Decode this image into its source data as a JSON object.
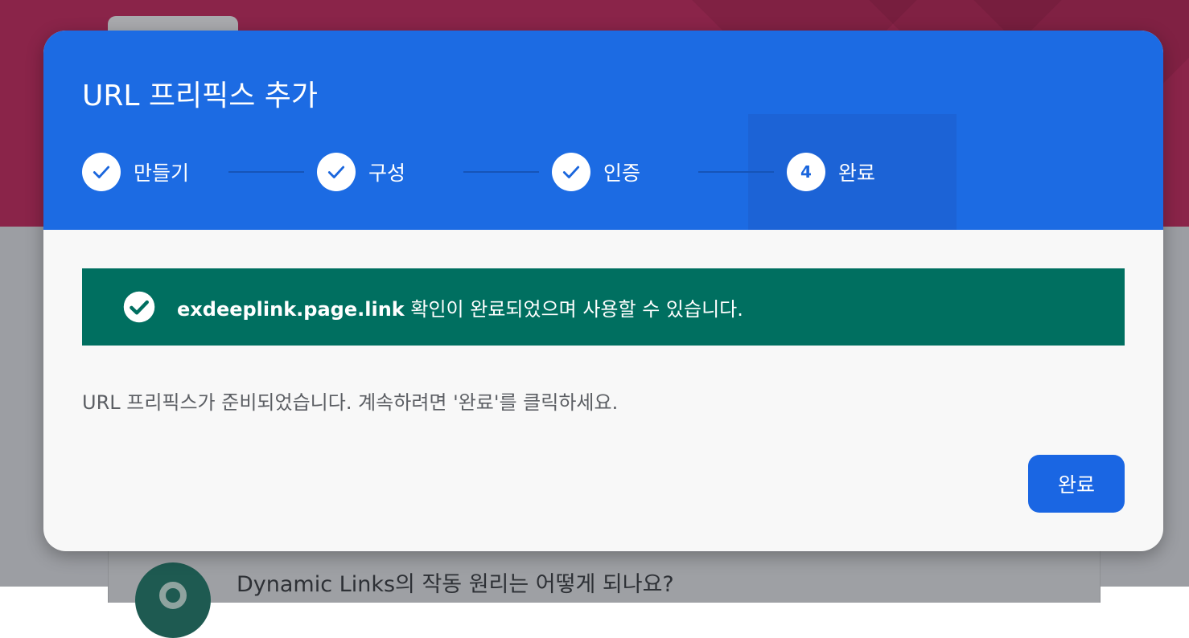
{
  "background": {
    "card_title": "Dynamic Links의 작동 원리는 어떻게 되나요?"
  },
  "dialog": {
    "title": "URL 프리픽스 추가",
    "steps": [
      {
        "label": "만들기",
        "state": "completed",
        "icon": "check-icon"
      },
      {
        "label": "구성",
        "state": "completed",
        "icon": "check-icon"
      },
      {
        "label": "인증",
        "state": "completed",
        "icon": "check-icon"
      },
      {
        "label": "완료",
        "state": "current",
        "number": "4"
      }
    ],
    "success": {
      "icon": "check-circle-icon",
      "domain": "exdeeplink.page.link",
      "message": " 확인이 완료되었으며 사용할 수 있습니다."
    },
    "body_text": "URL 프리픽스가 준비되었습니다. 계속하려면 '완료'를 클릭하세요.",
    "done_label": "완료"
  },
  "colors": {
    "header_blue": "#1c6be3",
    "success_green": "#006f60",
    "banner_maroon": "#8a2449",
    "button_blue": "#1a66e3"
  }
}
